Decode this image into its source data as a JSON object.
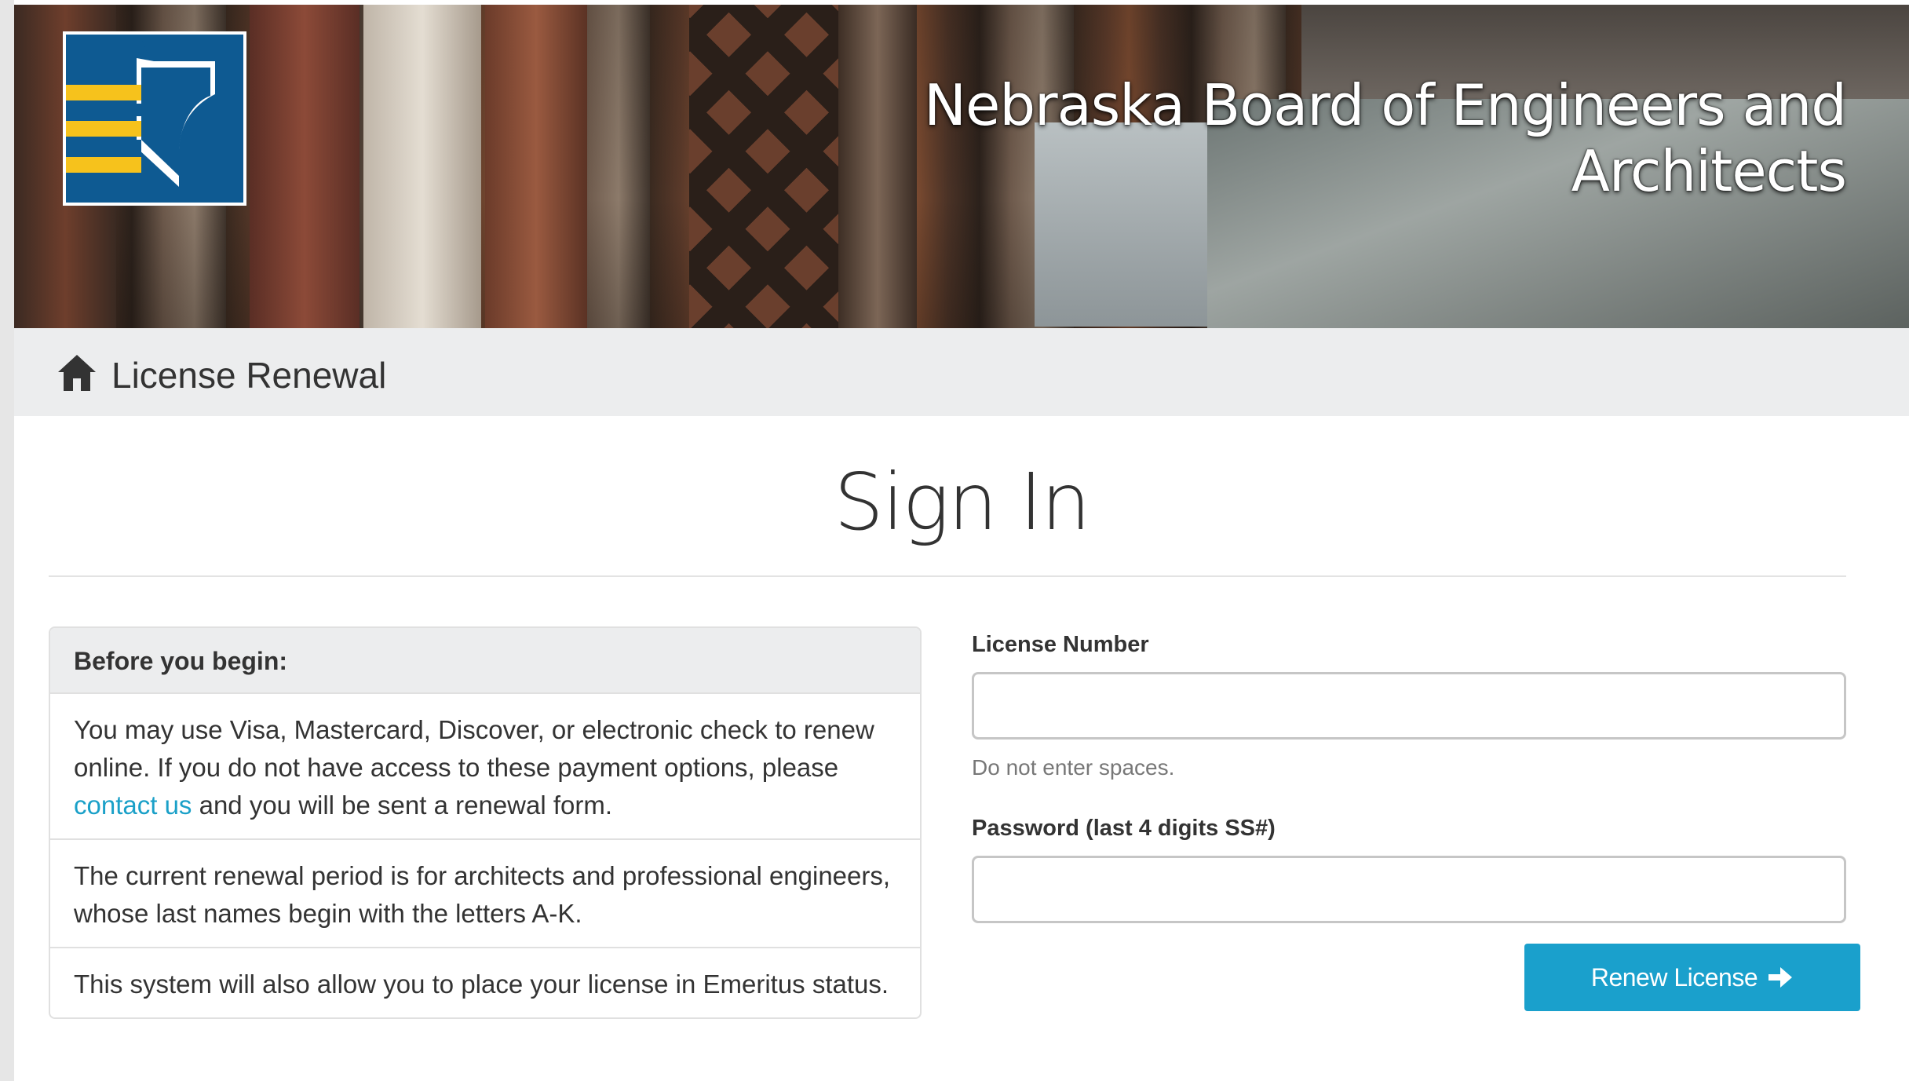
{
  "banner": {
    "title": "Nebraska Board of Engineers and Architects",
    "logo_colors": {
      "blue": "#0e5a92",
      "yellow": "#f6c21c"
    }
  },
  "breadcrumb": {
    "icon": "home-icon",
    "title": "License Renewal"
  },
  "page": {
    "heading": "Sign In"
  },
  "info_panel": {
    "header": "Before you begin:",
    "item1_text_before": "You may use Visa, Mastercard, Discover, or electronic check to renew online. If you do not have access to these payment options, please ",
    "item1_link": "contact us",
    "item1_text_after": " and you will be sent a renewal form.",
    "item2": "The current renewal period is for architects and professional engineers, whose last names begin with the letters A-K.",
    "item3": "This system will also allow you to place your license in Emeritus status."
  },
  "form": {
    "license_label": "License Number",
    "license_value": "",
    "license_help": "Do not enter spaces.",
    "password_label": "Password (last 4 digits SS#)",
    "password_value": "",
    "submit_label": "Renew License",
    "submit_icon": "arrow-right-icon",
    "accent_color": "#1aa0cc"
  }
}
